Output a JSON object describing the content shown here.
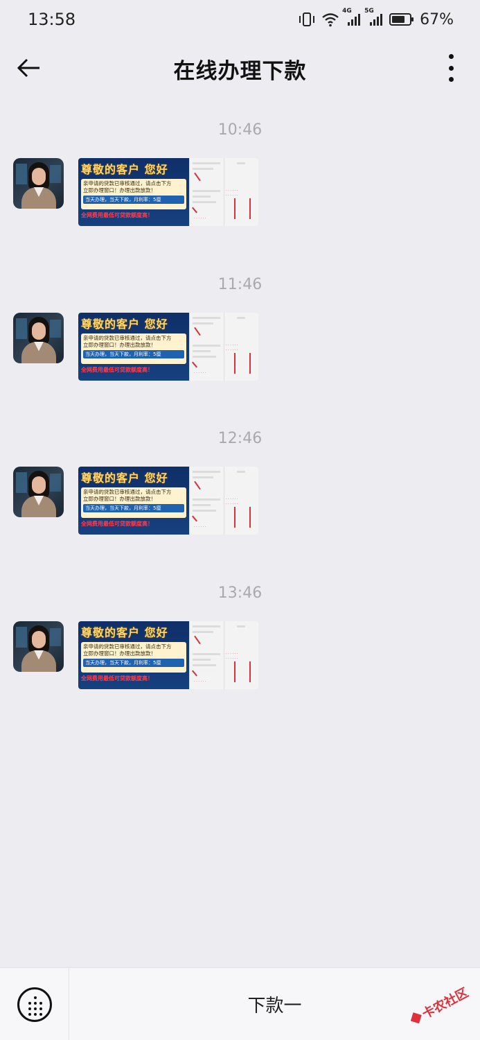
{
  "status_bar": {
    "time": "13:58",
    "battery": "67%",
    "net1": "4G",
    "net2": "5G"
  },
  "header": {
    "title": "在线办理下款"
  },
  "messages": [
    {
      "time": "10:46"
    },
    {
      "time": "11:46"
    },
    {
      "time": "12:46"
    },
    {
      "time": "13:46"
    }
  ],
  "card": {
    "title": "尊敬的客户 您好",
    "line1": "亲申请的贷款已审核通过，请点击下方",
    "line2": "立即办理窗口！办理出款放款！",
    "strip": "当天办理，当天下款，月利率：5厘",
    "footer": "全网费用最低可贷款额度高！"
  },
  "bottom": {
    "menu_label": "下款一",
    "watermark": "卡农社区"
  },
  "colors": {
    "background": "#ededf1",
    "banner": "#0f2f68",
    "accent_red": "#e0313b"
  }
}
